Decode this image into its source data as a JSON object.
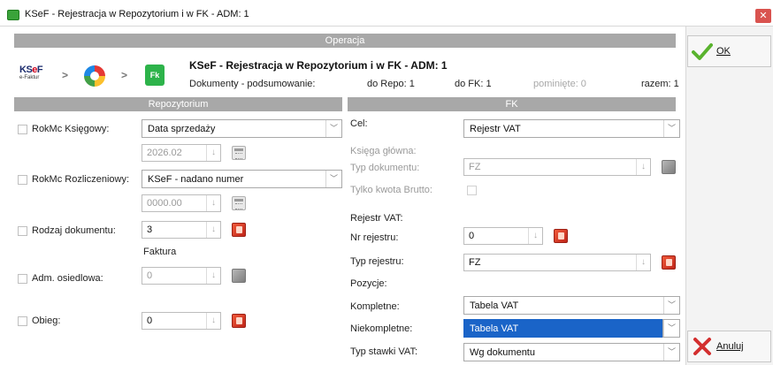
{
  "window": {
    "title": "KSeF - Rejestracja w Repozytorium i w FK - ADM: 1",
    "close_glyph": "✕"
  },
  "operation": {
    "section_title": "Operacja",
    "heading": "KSeF - Rejestracja w Repozytorium i w FK - ADM: 1",
    "summary_label": "Dokumenty - podsumowanie:",
    "to_repo": "do Repo: 1",
    "to_fk": "do FK: 1",
    "skipped": "pominięte: 0",
    "total": "razem: 1",
    "logo_ksef_main": "KS",
    "logo_ksef_e": "e",
    "logo_ksef_f": "F",
    "logo_ksef_sub": "e-Faktur",
    "logo_fk": "Fk",
    "arrow": ">"
  },
  "repo": {
    "section_title": "Repozytorium",
    "rokmc_ksiegowy_label": "RokMc Księgowy:",
    "rokmc_ksiegowy_value": "Data sprzedaży",
    "rokmc_ksiegowy_period": "2026.02",
    "rokmc_rozliczeniowy_label": "RokMc Rozliczeniowy:",
    "rokmc_rozliczeniowy_value": "KSeF - nadano numer",
    "rokmc_rozliczeniowy_period": "0000.00",
    "rodzaj_label": "Rodzaj dokumentu:",
    "rodzaj_value": "3",
    "rodzaj_desc": "Faktura",
    "adm_label": "Adm. osiedlowa:",
    "adm_value": "0",
    "obieg_label": "Obieg:",
    "obieg_value": "0"
  },
  "fk": {
    "section_title": "FK",
    "cel_label": "Cel:",
    "cel_value": "Rejestr VAT",
    "ksiega_label": "Księga główna:",
    "typ_dok_label": "Typ dokumentu:",
    "typ_dok_value": "FZ",
    "tylko_brutto_label": "Tylko kwota Brutto:",
    "rejestr_vat_label": "Rejestr VAT:",
    "nr_rejestru_label": "Nr rejestru:",
    "nr_rejestru_value": "0",
    "typ_rejestru_label": "Typ rejestru:",
    "typ_rejestru_value": "FZ",
    "pozycje_label": "Pozycje:",
    "kompletne_label": "Kompletne:",
    "kompletne_value": "Tabela VAT",
    "niekompletne_label": "Niekompletne:",
    "niekompletne_value": "Tabela VAT",
    "typ_stawki_label": "Typ stawki VAT:",
    "typ_stawki_value": "Wg dokumentu"
  },
  "buttons": {
    "ok_label": "OK",
    "cancel_label": "Anuluj"
  },
  "glyphs": {
    "dropdown": "﹀",
    "spin_down": "↓"
  },
  "colors": {
    "accent": "#1a64c8",
    "section_header": "#a8a8a8",
    "ok_green": "#59b32e",
    "cancel_red": "#d32f2f"
  }
}
